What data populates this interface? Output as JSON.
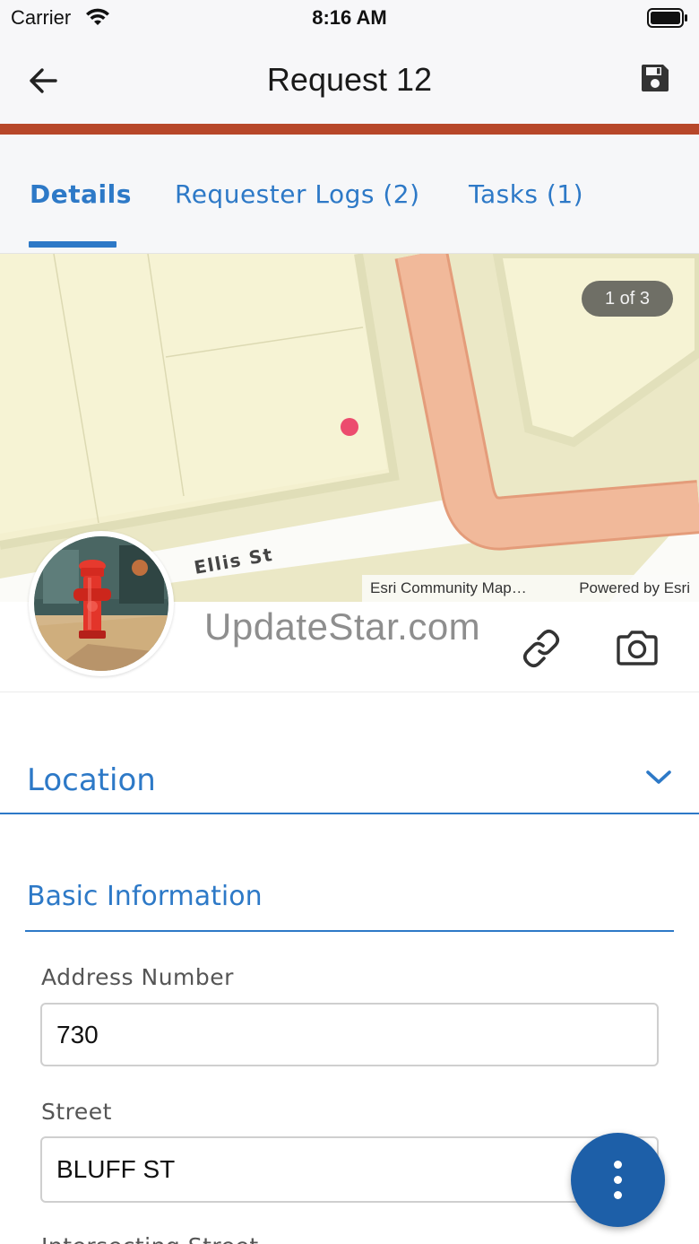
{
  "status_bar": {
    "carrier": "Carrier",
    "time": "8:16 AM"
  },
  "nav": {
    "title": "Request 12",
    "back_icon": "arrow-left-icon",
    "save_icon": "floppy-disk-icon"
  },
  "colors": {
    "accent_bar": "#b7472a",
    "primary": "#2d79c7",
    "fab": "#1d5fa8",
    "map_background": "#f4f0cf",
    "road": "#f1b99a"
  },
  "tabs": [
    {
      "label": "Details",
      "selected": true
    },
    {
      "label": "Requester Logs (2)",
      "selected": false
    },
    {
      "label": "Tasks (1)",
      "selected": false
    }
  ],
  "map": {
    "page_indicator": "1 of 3",
    "street_label": "Ellis St",
    "attribution_left": "Esri Community Map…",
    "attribution_right": "Powered by Esri"
  },
  "media": {
    "watermark": "UpdateStar.com",
    "link_icon": "link-icon",
    "camera_icon": "camera-icon",
    "avatar_subject": "fire-hydrant-photo"
  },
  "sections": {
    "location": {
      "title": "Location",
      "icon": "chevron-down-icon"
    },
    "basic_information": {
      "title": "Basic Information"
    }
  },
  "fields": [
    {
      "label": "Address Number",
      "value": "730"
    },
    {
      "label": "Street",
      "value": "BLUFF ST"
    },
    {
      "label": "Intersecting Street",
      "value": ""
    }
  ],
  "fab": {
    "icon": "more-vertical-icon"
  }
}
